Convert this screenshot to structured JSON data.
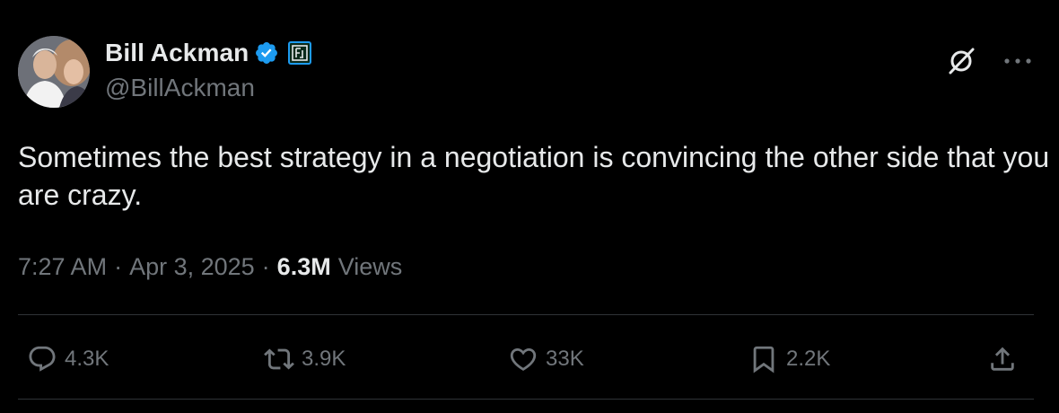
{
  "author": {
    "display_name": "Bill Ackman",
    "handle": "@BillAckman",
    "verified": true,
    "affiliate_badge_icon": "affiliate-logo-icon"
  },
  "tweet": {
    "text": "Sometimes the best strategy in a negotiation is convincing the other side that you are crazy."
  },
  "meta": {
    "time": "7:27 AM",
    "separator": "·",
    "date": "Apr 3, 2025",
    "views_count": "6.3M",
    "views_label": "Views"
  },
  "actions": {
    "replies": "4.3K",
    "reposts": "3.9K",
    "likes": "33K",
    "bookmarks": "2.2K"
  },
  "colors": {
    "background": "#000000",
    "text": "#e7e9ea",
    "secondary": "#71767b",
    "verified": "#1d9bf0",
    "divider": "#2f3336"
  }
}
